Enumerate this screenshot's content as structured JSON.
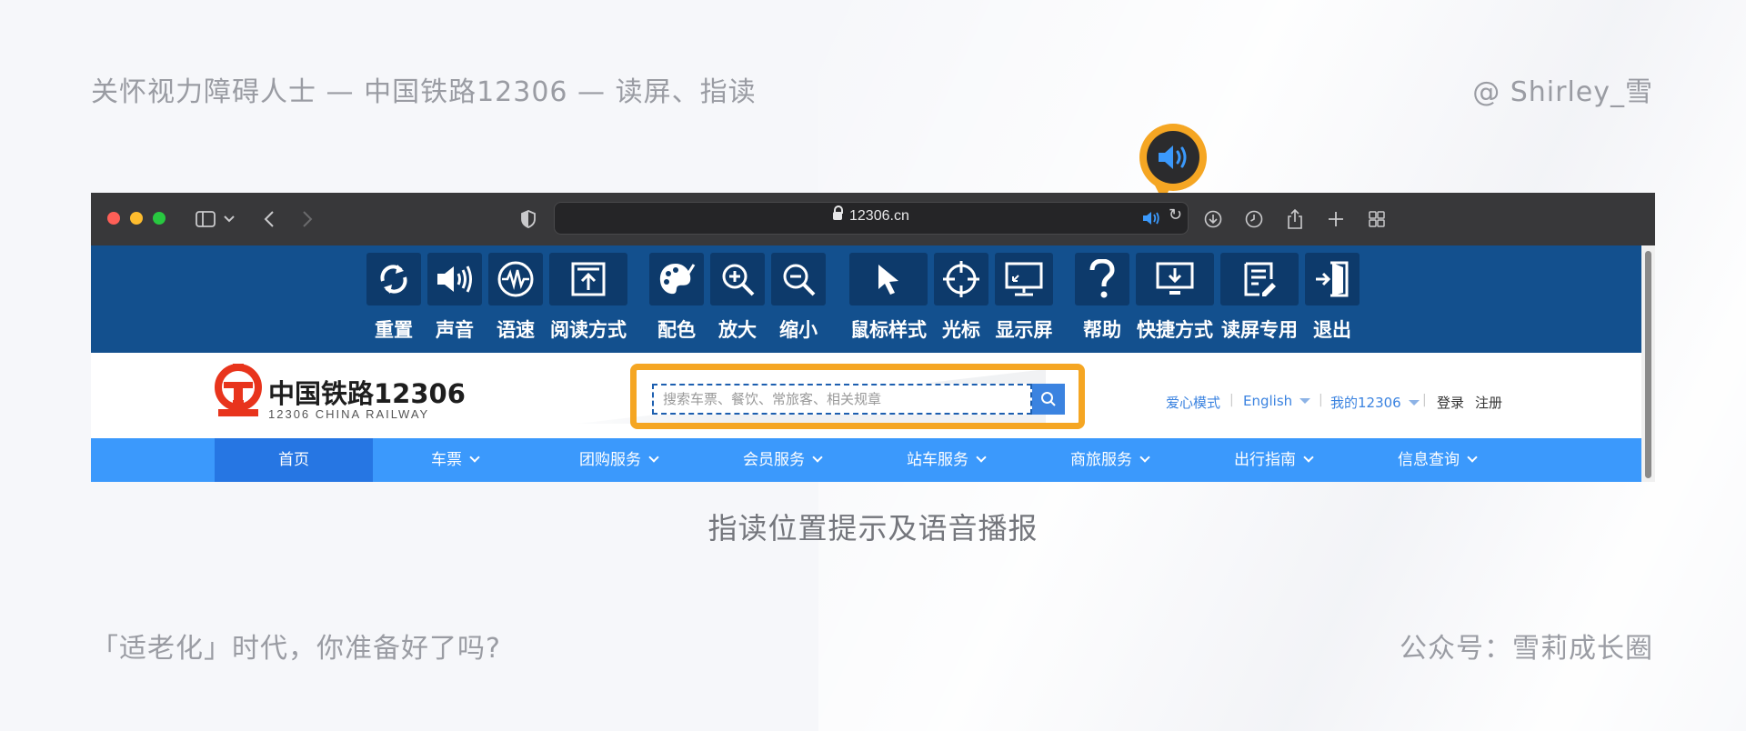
{
  "captions": {
    "top_left": "关怀视力障碍人士 — 中国铁路12306 — 读屏、指读",
    "top_right": "@ Shirley_雪",
    "center": "指读位置提示及语音播报",
    "bottom_left": "「适老化」时代，你准备好了吗?",
    "bottom_right": "公众号：雪莉成长圈"
  },
  "browser": {
    "url": "12306.cn"
  },
  "a11y_toolbar": {
    "tools": [
      {
        "label": "重置",
        "icon": "refresh-icon"
      },
      {
        "label": "声音",
        "icon": "speaker-icon"
      },
      {
        "label": "语速",
        "icon": "waveform-icon"
      },
      {
        "label": "阅读方式",
        "icon": "upload-icon"
      },
      {
        "label": "配色",
        "icon": "palette-icon"
      },
      {
        "label": "放大",
        "icon": "zoom-in-icon"
      },
      {
        "label": "缩小",
        "icon": "zoom-out-icon"
      },
      {
        "label": "鼠标样式",
        "icon": "cursor-icon"
      },
      {
        "label": "光标",
        "icon": "crosshair-icon"
      },
      {
        "label": "显示屏",
        "icon": "monitor-icon"
      },
      {
        "label": "帮助",
        "icon": "help-icon"
      },
      {
        "label": "快捷方式",
        "icon": "shortcut-icon"
      },
      {
        "label": "读屏专用",
        "icon": "document-icon"
      },
      {
        "label": "退出",
        "icon": "exit-icon"
      }
    ]
  },
  "site": {
    "logo_cn": "中国铁路12306",
    "logo_en": "12306 CHINA RAILWAY",
    "search_placeholder": "搜索车票、餐饮、常旅客、相关规章",
    "header_links": {
      "care_mode": "爱心模式",
      "english": "English",
      "my12306": "我的12306",
      "login": "登录",
      "register": "注册"
    },
    "nav": [
      "首页",
      "车票",
      "团购服务",
      "会员服务",
      "站车服务",
      "商旅服务",
      "出行指南",
      "信息查询"
    ]
  },
  "colors": {
    "toolbar_bg": "#13508e",
    "nav_bg": "#3b99fc",
    "highlight": "#f5a623",
    "brand_red": "#e8341c"
  }
}
